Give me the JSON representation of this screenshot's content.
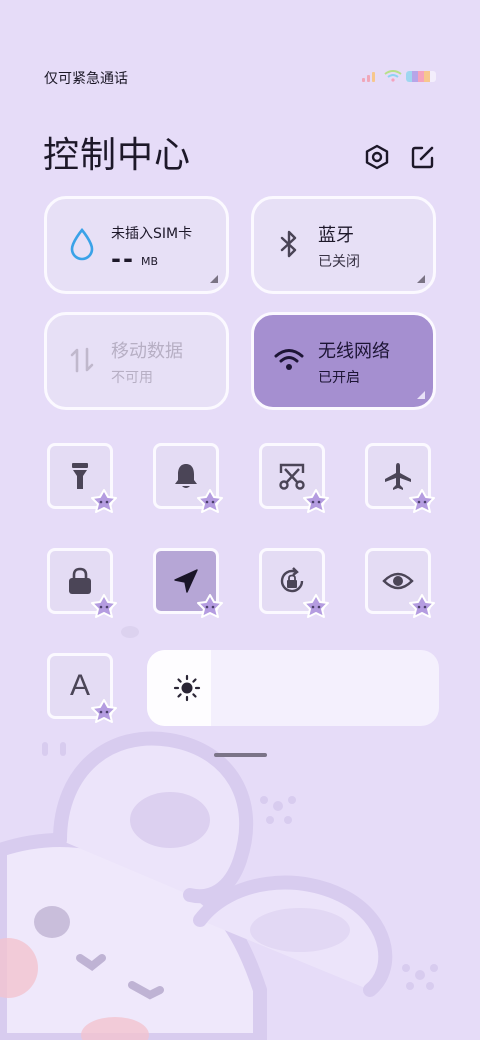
{
  "status_bar": {
    "text": "仅可紧急通话"
  },
  "header": {
    "title": "控制中心",
    "settings_icon": "hexagon-settings-icon",
    "edit_icon": "edit-icon"
  },
  "tiles": {
    "sim": {
      "title": "未插入SIM卡",
      "value": "--",
      "unit": "MB",
      "icon": "water-drop-icon"
    },
    "bluetooth": {
      "title": "蓝牙",
      "status": "已关闭",
      "icon": "bluetooth-icon"
    },
    "mobile_data": {
      "title": "移动数据",
      "status": "不可用",
      "icon": "data-arrows-icon"
    },
    "wifi": {
      "title": "无线网络",
      "status": "已开启",
      "icon": "wifi-icon"
    }
  },
  "toggles": [
    {
      "name": "flashlight",
      "icon": "flashlight-icon",
      "on": false
    },
    {
      "name": "sound",
      "icon": "bell-icon",
      "on": false
    },
    {
      "name": "screenshot",
      "icon": "scissors-icon",
      "on": false
    },
    {
      "name": "airplane",
      "icon": "airplane-icon",
      "on": false
    },
    {
      "name": "lock",
      "icon": "lock-icon",
      "on": false
    },
    {
      "name": "location",
      "icon": "location-arrow-icon",
      "on": true
    },
    {
      "name": "rotation-lock",
      "icon": "rotation-lock-icon",
      "on": false
    },
    {
      "name": "eye-comfort",
      "icon": "eye-icon",
      "on": false
    },
    {
      "name": "font",
      "icon": "font-a-icon",
      "label": "A",
      "on": false
    }
  ],
  "brightness": {
    "level": 0.22,
    "icon": "sun-icon"
  },
  "colors": {
    "accent": "#a58fd0",
    "background": "#e6dcf8",
    "tile": "#e7e0f6",
    "sticker": "#b49ce0"
  }
}
